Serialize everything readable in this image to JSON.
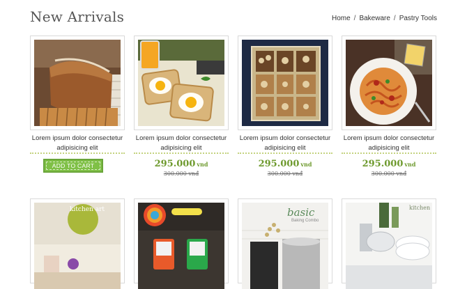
{
  "header": {
    "title": "New Arrivals",
    "breadcrumb": [
      "Home",
      "Bakeware",
      "Pastry Tools"
    ]
  },
  "products": [
    {
      "image": "bread-loaf-image",
      "name": "Lorem ipsum dolor consectetur adipisicing elit",
      "action": "ADD TO CART"
    },
    {
      "image": "toast-eggs-image",
      "name": "Lorem ipsum dolor consectetur adipisicing elit",
      "price": "295.000",
      "currency": "vnd",
      "old_price": "300.000 vnđ"
    },
    {
      "image": "snack-box-image",
      "name": "Lorem ipsum dolor consectetur adipisicing elit",
      "price": "295.000",
      "currency": "vnd",
      "old_price": "300.000 vnđ"
    },
    {
      "image": "pasta-plate-image",
      "name": "Lorem ipsum dolor consectetur adipisicing elit",
      "price": "295.000",
      "currency": "vnd",
      "old_price": "300.000 vnđ"
    }
  ],
  "products_row2": [
    {
      "image": "kitchen-art-image",
      "sign": "kitchen art"
    },
    {
      "image": "measuring-cups-image"
    },
    {
      "image": "basic-baking-combo-image",
      "sign_main": "basic",
      "sign_sub": "Baking Combo"
    },
    {
      "image": "kitchenware-set-image",
      "sign": "kitchen"
    }
  ]
}
